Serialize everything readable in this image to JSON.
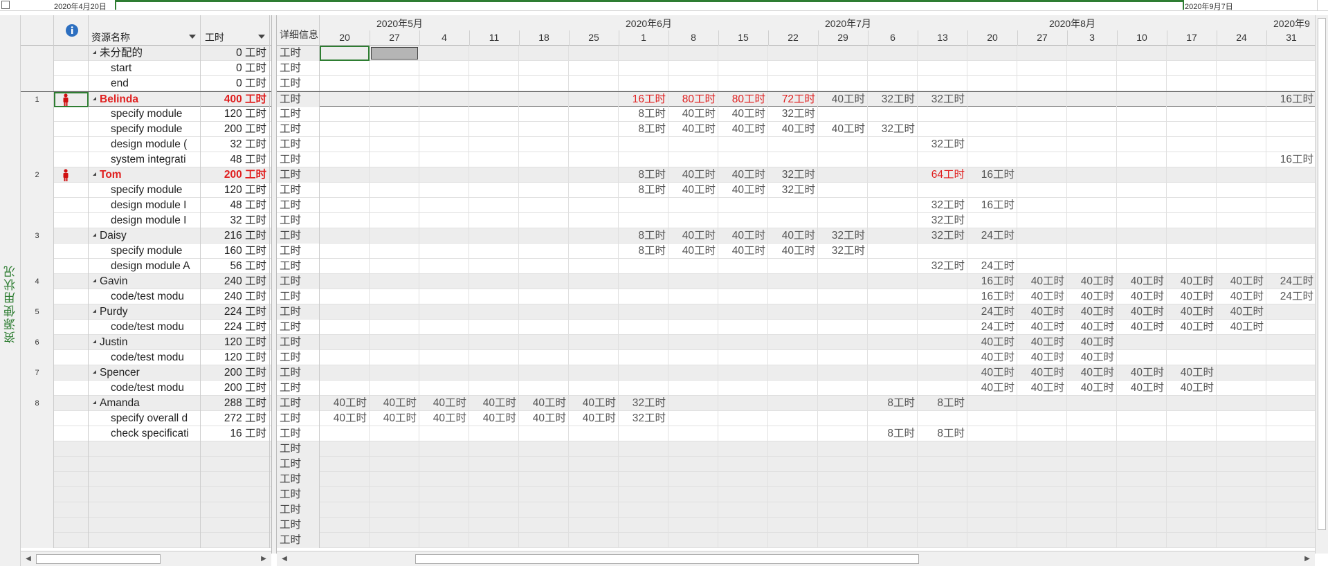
{
  "timeline": {
    "start_date": "2020年4月20日",
    "end_date": "2020年9月7日"
  },
  "sidebar": {
    "label": "资源使用状况"
  },
  "grid": {
    "headers": {
      "name": "资源名称",
      "work": "工时"
    },
    "rows": [
      {
        "id": "",
        "name": "未分配的",
        "work": "0 工时",
        "level": 0,
        "overalloc": false
      },
      {
        "id": "",
        "name": "start",
        "work": "0 工时",
        "level": 1,
        "overalloc": false
      },
      {
        "id": "",
        "name": "end",
        "work": "0 工时",
        "level": 1,
        "overalloc": false
      },
      {
        "id": "1",
        "name": "Belinda",
        "work": "400 工时",
        "level": 0,
        "overalloc": true
      },
      {
        "id": "",
        "name": "specify module",
        "work": "120 工时",
        "level": 1,
        "overalloc": false
      },
      {
        "id": "",
        "name": "specify module",
        "work": "200 工时",
        "level": 1,
        "overalloc": false
      },
      {
        "id": "",
        "name": "design module (",
        "work": "32 工时",
        "level": 1,
        "overalloc": false
      },
      {
        "id": "",
        "name": "system integrati",
        "work": "48 工时",
        "level": 1,
        "overalloc": false
      },
      {
        "id": "2",
        "name": "Tom",
        "work": "200 工时",
        "level": 0,
        "overalloc": true
      },
      {
        "id": "",
        "name": "specify module",
        "work": "120 工时",
        "level": 1,
        "overalloc": false
      },
      {
        "id": "",
        "name": "design module I",
        "work": "48 工时",
        "level": 1,
        "overalloc": false
      },
      {
        "id": "",
        "name": "design module I",
        "work": "32 工时",
        "level": 1,
        "overalloc": false
      },
      {
        "id": "3",
        "name": "Daisy",
        "work": "216 工时",
        "level": 0,
        "overalloc": false
      },
      {
        "id": "",
        "name": "specify module",
        "work": "160 工时",
        "level": 1,
        "overalloc": false
      },
      {
        "id": "",
        "name": "design module A",
        "work": "56 工时",
        "level": 1,
        "overalloc": false
      },
      {
        "id": "4",
        "name": "Gavin",
        "work": "240 工时",
        "level": 0,
        "overalloc": false
      },
      {
        "id": "",
        "name": "code/test modu",
        "work": "240 工时",
        "level": 1,
        "overalloc": false
      },
      {
        "id": "5",
        "name": "Purdy",
        "work": "224 工时",
        "level": 0,
        "overalloc": false
      },
      {
        "id": "",
        "name": "code/test modu",
        "work": "224 工时",
        "level": 1,
        "overalloc": false
      },
      {
        "id": "6",
        "name": "Justin",
        "work": "120 工时",
        "level": 0,
        "overalloc": false
      },
      {
        "id": "",
        "name": "code/test modu",
        "work": "120 工时",
        "level": 1,
        "overalloc": false
      },
      {
        "id": "7",
        "name": "Spencer",
        "work": "200 工时",
        "level": 0,
        "overalloc": false
      },
      {
        "id": "",
        "name": "code/test modu",
        "work": "200 工时",
        "level": 1,
        "overalloc": false
      },
      {
        "id": "8",
        "name": "Amanda",
        "work": "288 工时",
        "level": 0,
        "overalloc": false
      },
      {
        "id": "",
        "name": "specify overall d",
        "work": "272 工时",
        "level": 1,
        "overalloc": false
      },
      {
        "id": "",
        "name": "check specificati",
        "work": "16 工时",
        "level": 1,
        "overalloc": false
      }
    ]
  },
  "usage": {
    "detail_header": "详细信息",
    "detail_label": "工时",
    "months": [
      {
        "label": "2020年5月",
        "col": 1
      },
      {
        "label": "2020年6月",
        "col": 6
      },
      {
        "label": "2020年7月",
        "col": 10
      },
      {
        "label": "2020年8月",
        "col": 14.5
      },
      {
        "label": "2020年9",
        "col": 19
      }
    ],
    "weeks": [
      "20",
      "27",
      "4",
      "11",
      "18",
      "25",
      "1",
      "8",
      "15",
      "22",
      "29",
      "6",
      "13",
      "20",
      "27",
      "3",
      "10",
      "17",
      "24",
      "31"
    ],
    "cells": [
      [],
      [],
      [],
      [
        {
          "c": 6,
          "v": "16工时",
          "o": true
        },
        {
          "c": 7,
          "v": "80工时",
          "o": true
        },
        {
          "c": 8,
          "v": "80工时",
          "o": true
        },
        {
          "c": 9,
          "v": "72工时",
          "o": true
        },
        {
          "c": 10,
          "v": "40工时"
        },
        {
          "c": 11,
          "v": "32工时"
        },
        {
          "c": 12,
          "v": "32工时"
        },
        {
          "c": 19,
          "v": "16工时"
        }
      ],
      [
        {
          "c": 6,
          "v": "8工时"
        },
        {
          "c": 7,
          "v": "40工时"
        },
        {
          "c": 8,
          "v": "40工时"
        },
        {
          "c": 9,
          "v": "32工时"
        }
      ],
      [
        {
          "c": 6,
          "v": "8工时"
        },
        {
          "c": 7,
          "v": "40工时"
        },
        {
          "c": 8,
          "v": "40工时"
        },
        {
          "c": 9,
          "v": "40工时"
        },
        {
          "c": 10,
          "v": "40工时"
        },
        {
          "c": 11,
          "v": "32工时"
        }
      ],
      [
        {
          "c": 12,
          "v": "32工时"
        }
      ],
      [
        {
          "c": 19,
          "v": "16工时"
        }
      ],
      [
        {
          "c": 6,
          "v": "8工时"
        },
        {
          "c": 7,
          "v": "40工时"
        },
        {
          "c": 8,
          "v": "40工时"
        },
        {
          "c": 9,
          "v": "32工时"
        },
        {
          "c": 12,
          "v": "64工时",
          "o": true
        },
        {
          "c": 13,
          "v": "16工时"
        }
      ],
      [
        {
          "c": 6,
          "v": "8工时"
        },
        {
          "c": 7,
          "v": "40工时"
        },
        {
          "c": 8,
          "v": "40工时"
        },
        {
          "c": 9,
          "v": "32工时"
        }
      ],
      [
        {
          "c": 12,
          "v": "32工时"
        },
        {
          "c": 13,
          "v": "16工时"
        }
      ],
      [
        {
          "c": 12,
          "v": "32工时"
        }
      ],
      [
        {
          "c": 6,
          "v": "8工时"
        },
        {
          "c": 7,
          "v": "40工时"
        },
        {
          "c": 8,
          "v": "40工时"
        },
        {
          "c": 9,
          "v": "40工时"
        },
        {
          "c": 10,
          "v": "32工时"
        },
        {
          "c": 12,
          "v": "32工时"
        },
        {
          "c": 13,
          "v": "24工时"
        }
      ],
      [
        {
          "c": 6,
          "v": "8工时"
        },
        {
          "c": 7,
          "v": "40工时"
        },
        {
          "c": 8,
          "v": "40工时"
        },
        {
          "c": 9,
          "v": "40工时"
        },
        {
          "c": 10,
          "v": "32工时"
        }
      ],
      [
        {
          "c": 12,
          "v": "32工时"
        },
        {
          "c": 13,
          "v": "24工时"
        }
      ],
      [
        {
          "c": 13,
          "v": "16工时"
        },
        {
          "c": 14,
          "v": "40工时"
        },
        {
          "c": 15,
          "v": "40工时"
        },
        {
          "c": 16,
          "v": "40工时"
        },
        {
          "c": 17,
          "v": "40工时"
        },
        {
          "c": 18,
          "v": "40工时"
        },
        {
          "c": 19,
          "v": "24工时"
        }
      ],
      [
        {
          "c": 13,
          "v": "16工时"
        },
        {
          "c": 14,
          "v": "40工时"
        },
        {
          "c": 15,
          "v": "40工时"
        },
        {
          "c": 16,
          "v": "40工时"
        },
        {
          "c": 17,
          "v": "40工时"
        },
        {
          "c": 18,
          "v": "40工时"
        },
        {
          "c": 19,
          "v": "24工时"
        }
      ],
      [
        {
          "c": 13,
          "v": "24工时"
        },
        {
          "c": 14,
          "v": "40工时"
        },
        {
          "c": 15,
          "v": "40工时"
        },
        {
          "c": 16,
          "v": "40工时"
        },
        {
          "c": 17,
          "v": "40工时"
        },
        {
          "c": 18,
          "v": "40工时"
        }
      ],
      [
        {
          "c": 13,
          "v": "24工时"
        },
        {
          "c": 14,
          "v": "40工时"
        },
        {
          "c": 15,
          "v": "40工时"
        },
        {
          "c": 16,
          "v": "40工时"
        },
        {
          "c": 17,
          "v": "40工时"
        },
        {
          "c": 18,
          "v": "40工时"
        }
      ],
      [
        {
          "c": 13,
          "v": "40工时"
        },
        {
          "c": 14,
          "v": "40工时"
        },
        {
          "c": 15,
          "v": "40工时"
        }
      ],
      [
        {
          "c": 13,
          "v": "40工时"
        },
        {
          "c": 14,
          "v": "40工时"
        },
        {
          "c": 15,
          "v": "40工时"
        }
      ],
      [
        {
          "c": 13,
          "v": "40工时"
        },
        {
          "c": 14,
          "v": "40工时"
        },
        {
          "c": 15,
          "v": "40工时"
        },
        {
          "c": 16,
          "v": "40工时"
        },
        {
          "c": 17,
          "v": "40工时"
        }
      ],
      [
        {
          "c": 13,
          "v": "40工时"
        },
        {
          "c": 14,
          "v": "40工时"
        },
        {
          "c": 15,
          "v": "40工时"
        },
        {
          "c": 16,
          "v": "40工时"
        },
        {
          "c": 17,
          "v": "40工时"
        }
      ],
      [
        {
          "c": 0,
          "v": "40工时"
        },
        {
          "c": 1,
          "v": "40工时"
        },
        {
          "c": 2,
          "v": "40工时"
        },
        {
          "c": 3,
          "v": "40工时"
        },
        {
          "c": 4,
          "v": "40工时"
        },
        {
          "c": 5,
          "v": "40工时"
        },
        {
          "c": 6,
          "v": "32工时"
        },
        {
          "c": 11,
          "v": "8工时"
        },
        {
          "c": 12,
          "v": "8工时"
        }
      ],
      [
        {
          "c": 0,
          "v": "40工时"
        },
        {
          "c": 1,
          "v": "40工时"
        },
        {
          "c": 2,
          "v": "40工时"
        },
        {
          "c": 3,
          "v": "40工时"
        },
        {
          "c": 4,
          "v": "40工时"
        },
        {
          "c": 5,
          "v": "40工时"
        },
        {
          "c": 6,
          "v": "32工时"
        }
      ],
      [
        {
          "c": 11,
          "v": "8工时"
        },
        {
          "c": 12,
          "v": "8工时"
        }
      ]
    ]
  }
}
